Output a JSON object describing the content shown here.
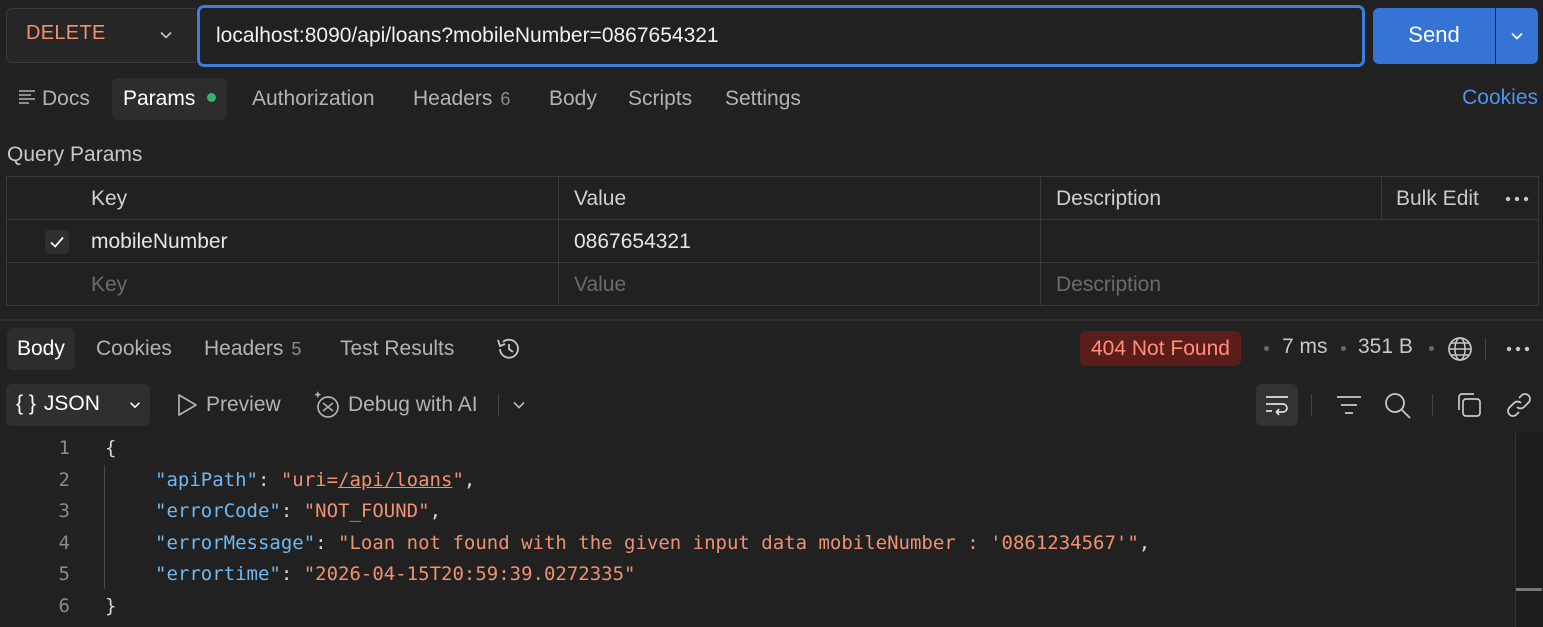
{
  "request": {
    "method": "DELETE",
    "url": "localhost:8090/api/loans?mobileNumber=0867654321",
    "send_label": "Send"
  },
  "request_tabs": {
    "docs": "Docs",
    "params": "Params",
    "authorization": "Authorization",
    "headers": "Headers",
    "headers_count": "6",
    "body": "Body",
    "scripts": "Scripts",
    "settings": "Settings",
    "cookies": "Cookies"
  },
  "query_params": {
    "title": "Query Params",
    "columns": {
      "key": "Key",
      "value": "Value",
      "description": "Description",
      "bulk_edit": "Bulk Edit"
    },
    "rows": [
      {
        "key": "mobileNumber",
        "value": "0867654321",
        "description": "",
        "enabled": true
      }
    ],
    "placeholders": {
      "key": "Key",
      "value": "Value",
      "description": "Description"
    }
  },
  "response": {
    "tabs": {
      "body": "Body",
      "cookies": "Cookies",
      "headers": "Headers",
      "headers_count": "5",
      "test_results": "Test Results"
    },
    "status": "404 Not Found",
    "time": "7 ms",
    "size": "351 B",
    "format": "JSON",
    "preview": "Preview",
    "debug_ai": "Debug with AI",
    "line_numbers": [
      "1",
      "2",
      "3",
      "4",
      "5",
      "6"
    ],
    "json": {
      "apiPath_key": "\"apiPath\"",
      "apiPath_prefix": "\"uri=",
      "apiPath_link": "/api/loans",
      "apiPath_suffix": "\"",
      "errorCode_key": "\"errorCode\"",
      "errorCode_val": "\"NOT_FOUND\"",
      "errorMessage_key": "\"errorMessage\"",
      "errorMessage_val": "\"Loan not found with the given input data mobileNumber : '0861234567'\"",
      "errortime_key": "\"errortime\"",
      "errortime_val": "\"2026-04-15T20:59:39.0272335\""
    }
  },
  "colors": {
    "accent": "#3573d5",
    "method": "#f58f6e",
    "status_bg": "#5b1d19",
    "status_text": "#ff8e7a",
    "json_key": "#6fb8f2",
    "json_string": "#f0916f"
  }
}
